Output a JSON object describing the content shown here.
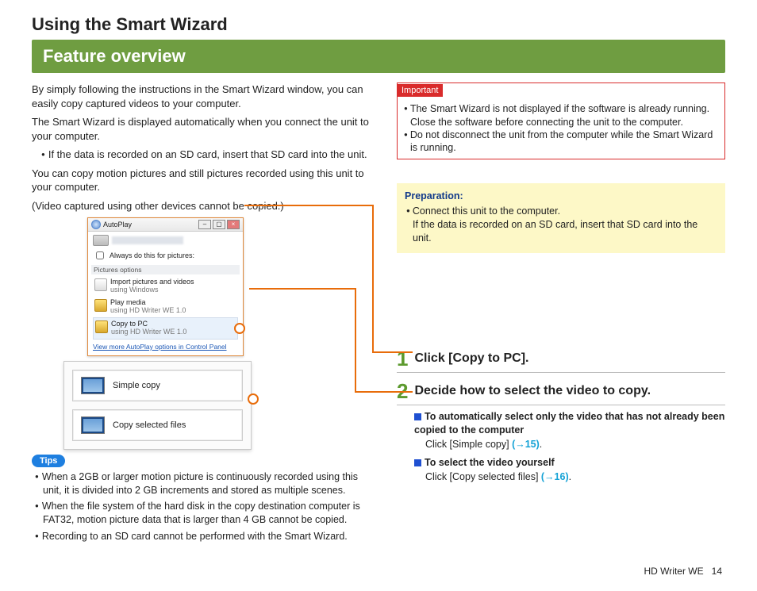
{
  "page_title": "Using the Smart Wizard",
  "banner": "Feature overview",
  "intro": {
    "p1": "By simply following the instructions in the Smart Wizard window, you can easily copy captured videos to your computer.",
    "p2": "The Smart Wizard is displayed automatically when you connect the unit to your computer.",
    "sd_note": "If the data is recorded on an SD card, insert that SD card into the unit.",
    "p3": "You can copy motion pictures and still pictures recorded using this unit to your computer.",
    "p4": "(Video captured using other devices cannot be copied.)"
  },
  "autoplay": {
    "title": "AutoPlay",
    "checkbox": "Always do this for pictures:",
    "section": "Pictures options",
    "item1_title": "Import pictures and videos",
    "item1_sub": "using Windows",
    "item2_title": "Play media",
    "item2_sub": "using HD Writer WE 1.0",
    "item3_title": "Copy to PC",
    "item3_sub": "using HD Writer WE 1.0",
    "link": "View more AutoPlay options in Control Panel"
  },
  "wizard_buttons": {
    "simple": "Simple copy",
    "selected": "Copy selected files"
  },
  "tips_label": "Tips",
  "tips": {
    "t1": "When a 2GB or larger motion picture is continuously recorded using this unit, it is divided into 2 GB increments and stored as multiple scenes.",
    "t2": "When the file system of the hard disk in the copy destination computer is FAT32, motion picture data that is larger than 4 GB cannot be copied.",
    "t3": "Recording to an SD card cannot be performed with the Smart Wizard."
  },
  "important_label": "Important",
  "important": {
    "i1": "The Smart Wizard is not displayed if the software is already running. Close the software before connecting the unit to the computer.",
    "i2": "Do not disconnect the unit from the computer while the Smart Wizard is running."
  },
  "prep_title": "Preparation:",
  "prep": {
    "p1": "Connect this unit to the computer.",
    "p1b": "If the data is recorded on an SD card, insert that SD card into the unit."
  },
  "steps": {
    "s1_num": "1",
    "s1_text": "Click [Copy to PC].",
    "s2_num": "2",
    "s2_text": "Decide how to select the video to copy.",
    "sub1_title": "To automatically select only the video that has not already been copied to the computer",
    "sub1_body": "Click [Simple copy] ",
    "sub1_ref": "(→15)",
    "sub1_dot": ".",
    "sub2_title": "To select the video yourself",
    "sub2_body": "Click [Copy selected files] ",
    "sub2_ref": "(→16)",
    "sub2_dot": "."
  },
  "footer_product": "HD Writer WE",
  "footer_page": "14"
}
